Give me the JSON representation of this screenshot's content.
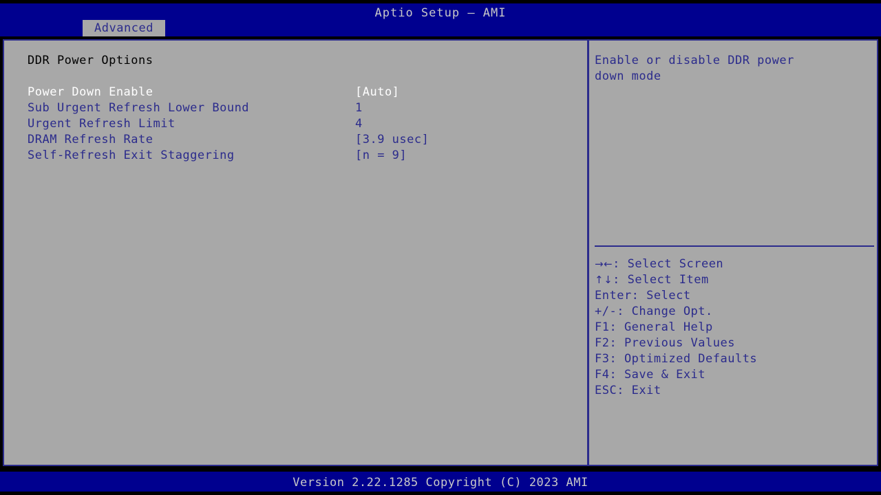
{
  "header": {
    "title": "Aptio Setup – AMI",
    "tabs": [
      {
        "label": "Advanced",
        "active": true
      }
    ]
  },
  "main": {
    "group_title": "DDR Power Options",
    "options": [
      {
        "label": "Power Down Enable",
        "value": "[Auto]",
        "selected": true
      },
      {
        "label": "Sub Urgent Refresh Lower Bound",
        "value": "1",
        "selected": false
      },
      {
        "label": "Urgent Refresh Limit",
        "value": "4",
        "selected": false
      },
      {
        "label": "DRAM Refresh Rate",
        "value": "[3.9 usec]",
        "selected": false
      },
      {
        "label": "Self-Refresh Exit Staggering",
        "value": "[n = 9]",
        "selected": false
      }
    ]
  },
  "help": {
    "lines": [
      "Enable or disable DDR power",
      "down mode"
    ]
  },
  "keys": [
    {
      "glyph": "→←",
      "text": ": Select Screen"
    },
    {
      "glyph": "↑↓",
      "text": ": Select Item"
    },
    {
      "glyph": "",
      "text": "Enter: Select"
    },
    {
      "glyph": "",
      "text": "+/-: Change Opt."
    },
    {
      "glyph": "",
      "text": "F1: General Help"
    },
    {
      "glyph": "",
      "text": "F2: Previous Values"
    },
    {
      "glyph": "",
      "text": "F3: Optimized Defaults"
    },
    {
      "glyph": "",
      "text": "F4: Save & Exit"
    },
    {
      "glyph": "",
      "text": "ESC: Exit"
    }
  ],
  "footer": {
    "version": "Version 2.22.1285 Copyright (C) 2023 AMI"
  },
  "colors": {
    "header_blue": "#00008F",
    "panel_gray": "#A8A8A8",
    "text_blue": "#2B2B8C",
    "text_white": "#FFFFFF",
    "text_black": "#000000",
    "footer_text": "#C8C8C8"
  }
}
